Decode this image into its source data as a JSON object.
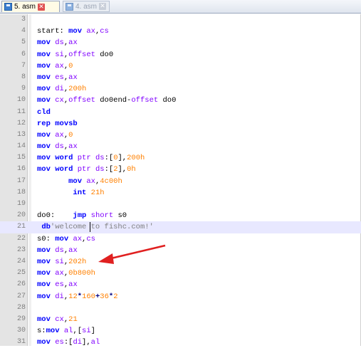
{
  "tabs": [
    {
      "label": "5. asm",
      "active": true
    },
    {
      "label": "4. asm",
      "active": false
    }
  ],
  "lines": [
    {
      "n": "3",
      "tokens": []
    },
    {
      "n": "4",
      "tokens": [
        [
          "t",
          "start: "
        ],
        [
          "kw",
          "mov"
        ],
        [
          "t",
          " "
        ],
        [
          "rg",
          "ax"
        ],
        [
          "t",
          ","
        ],
        [
          "rg",
          "cs"
        ]
      ]
    },
    {
      "n": "5",
      "tokens": [
        [
          "kw",
          "mov"
        ],
        [
          "t",
          " "
        ],
        [
          "rg",
          "ds"
        ],
        [
          "t",
          ","
        ],
        [
          "rg",
          "ax"
        ]
      ]
    },
    {
      "n": "6",
      "tokens": [
        [
          "kw",
          "mov"
        ],
        [
          "t",
          " "
        ],
        [
          "rg",
          "si"
        ],
        [
          "t",
          ","
        ],
        [
          "rg",
          "offset"
        ],
        [
          "t",
          " do0"
        ]
      ]
    },
    {
      "n": "7",
      "tokens": [
        [
          "kw",
          "mov"
        ],
        [
          "t",
          " "
        ],
        [
          "rg",
          "ax"
        ],
        [
          "t",
          ","
        ],
        [
          "nm",
          "0"
        ]
      ]
    },
    {
      "n": "8",
      "tokens": [
        [
          "kw",
          "mov"
        ],
        [
          "t",
          " "
        ],
        [
          "rg",
          "es"
        ],
        [
          "t",
          ","
        ],
        [
          "rg",
          "ax"
        ]
      ]
    },
    {
      "n": "9",
      "tokens": [
        [
          "kw",
          "mov"
        ],
        [
          "t",
          " "
        ],
        [
          "rg",
          "di"
        ],
        [
          "t",
          ","
        ],
        [
          "nm",
          "200h"
        ]
      ]
    },
    {
      "n": "10",
      "tokens": [
        [
          "kw",
          "mov"
        ],
        [
          "t",
          " "
        ],
        [
          "rg",
          "cx"
        ],
        [
          "t",
          ","
        ],
        [
          "rg",
          "offset"
        ],
        [
          "t",
          " do0end-"
        ],
        [
          "rg",
          "offset"
        ],
        [
          "t",
          " do0"
        ]
      ]
    },
    {
      "n": "11",
      "tokens": [
        [
          "kw",
          "cld"
        ]
      ]
    },
    {
      "n": "12",
      "tokens": [
        [
          "kw",
          "rep"
        ],
        [
          "t",
          " "
        ],
        [
          "kw",
          "movsb"
        ]
      ]
    },
    {
      "n": "13",
      "tokens": [
        [
          "kw",
          "mov"
        ],
        [
          "t",
          " "
        ],
        [
          "rg",
          "ax"
        ],
        [
          "t",
          ","
        ],
        [
          "nm",
          "0"
        ]
      ]
    },
    {
      "n": "14",
      "tokens": [
        [
          "kw",
          "mov"
        ],
        [
          "t",
          " "
        ],
        [
          "rg",
          "ds"
        ],
        [
          "t",
          ","
        ],
        [
          "rg",
          "ax"
        ]
      ]
    },
    {
      "n": "15",
      "tokens": [
        [
          "kw",
          "mov"
        ],
        [
          "t",
          " "
        ],
        [
          "kw",
          "word"
        ],
        [
          "t",
          " "
        ],
        [
          "rg",
          "ptr"
        ],
        [
          "t",
          " "
        ],
        [
          "rg",
          "ds"
        ],
        [
          "t",
          ":["
        ],
        [
          "nm",
          "0"
        ],
        [
          "t",
          "],"
        ],
        [
          "nm",
          "200h"
        ]
      ]
    },
    {
      "n": "16",
      "tokens": [
        [
          "kw",
          "mov"
        ],
        [
          "t",
          " "
        ],
        [
          "kw",
          "word"
        ],
        [
          "t",
          " "
        ],
        [
          "rg",
          "ptr"
        ],
        [
          "t",
          " "
        ],
        [
          "rg",
          "ds"
        ],
        [
          "t",
          ":["
        ],
        [
          "nm",
          "2"
        ],
        [
          "t",
          "],"
        ],
        [
          "nm",
          "0h"
        ]
      ]
    },
    {
      "n": "17",
      "tokens": [
        [
          "t",
          "       "
        ],
        [
          "kw",
          "mov"
        ],
        [
          "t",
          " "
        ],
        [
          "rg",
          "ax"
        ],
        [
          "t",
          ","
        ],
        [
          "nm",
          "4c00h"
        ]
      ]
    },
    {
      "n": "18",
      "tokens": [
        [
          "t",
          "        "
        ],
        [
          "kw",
          "int"
        ],
        [
          "t",
          " "
        ],
        [
          "nm",
          "21h"
        ]
      ]
    },
    {
      "n": "19",
      "tokens": []
    },
    {
      "n": "20",
      "tokens": [
        [
          "t",
          "do0:    "
        ],
        [
          "kw",
          "jmp"
        ],
        [
          "t",
          " "
        ],
        [
          "rg",
          "short"
        ],
        [
          "t",
          " s0"
        ]
      ]
    },
    {
      "n": "21",
      "tokens": [
        [
          "t",
          " "
        ],
        [
          "kw",
          "db"
        ],
        [
          "st",
          "'welcome to fishc.com!'"
        ]
      ],
      "caret": true
    },
    {
      "n": "22",
      "tokens": [
        [
          "t",
          "s0: "
        ],
        [
          "kw",
          "mov"
        ],
        [
          "t",
          " "
        ],
        [
          "rg",
          "ax"
        ],
        [
          "t",
          ","
        ],
        [
          "rg",
          "cs"
        ]
      ]
    },
    {
      "n": "23",
      "tokens": [
        [
          "kw",
          "mov"
        ],
        [
          "t",
          " "
        ],
        [
          "rg",
          "ds"
        ],
        [
          "t",
          ","
        ],
        [
          "rg",
          "ax"
        ]
      ]
    },
    {
      "n": "24",
      "tokens": [
        [
          "kw",
          "mov"
        ],
        [
          "t",
          " "
        ],
        [
          "rg",
          "si"
        ],
        [
          "t",
          ","
        ],
        [
          "nm",
          "202h"
        ]
      ]
    },
    {
      "n": "25",
      "tokens": [
        [
          "kw",
          "mov"
        ],
        [
          "t",
          " "
        ],
        [
          "rg",
          "ax"
        ],
        [
          "t",
          ","
        ],
        [
          "nm",
          "0b800h"
        ]
      ]
    },
    {
      "n": "26",
      "tokens": [
        [
          "kw",
          "mov"
        ],
        [
          "t",
          " "
        ],
        [
          "rg",
          "es"
        ],
        [
          "t",
          ","
        ],
        [
          "rg",
          "ax"
        ]
      ]
    },
    {
      "n": "27",
      "tokens": [
        [
          "kw",
          "mov"
        ],
        [
          "t",
          " "
        ],
        [
          "rg",
          "di"
        ],
        [
          "t",
          ","
        ],
        [
          "nm",
          "12"
        ],
        [
          "op",
          "*"
        ],
        [
          "nm",
          "160"
        ],
        [
          "op",
          "+"
        ],
        [
          "nm",
          "36"
        ],
        [
          "op",
          "*"
        ],
        [
          "nm",
          "2"
        ]
      ]
    },
    {
      "n": "28",
      "tokens": []
    },
    {
      "n": "29",
      "tokens": [
        [
          "kw",
          "mov"
        ],
        [
          "t",
          " "
        ],
        [
          "rg",
          "cx"
        ],
        [
          "t",
          ","
        ],
        [
          "nm",
          "21"
        ]
      ]
    },
    {
      "n": "30",
      "tokens": [
        [
          "t",
          "s:"
        ],
        [
          "kw",
          "mov"
        ],
        [
          "t",
          " "
        ],
        [
          "rg",
          "al"
        ],
        [
          "t",
          ",["
        ],
        [
          "rg",
          "si"
        ],
        [
          "t",
          "]"
        ]
      ]
    },
    {
      "n": "31",
      "tokens": [
        [
          "kw",
          "mov"
        ],
        [
          "t",
          " "
        ],
        [
          "rg",
          "es"
        ],
        [
          "t",
          ":["
        ],
        [
          "rg",
          "di"
        ],
        [
          "t",
          "],"
        ],
        [
          "rg",
          "al"
        ]
      ]
    }
  ]
}
